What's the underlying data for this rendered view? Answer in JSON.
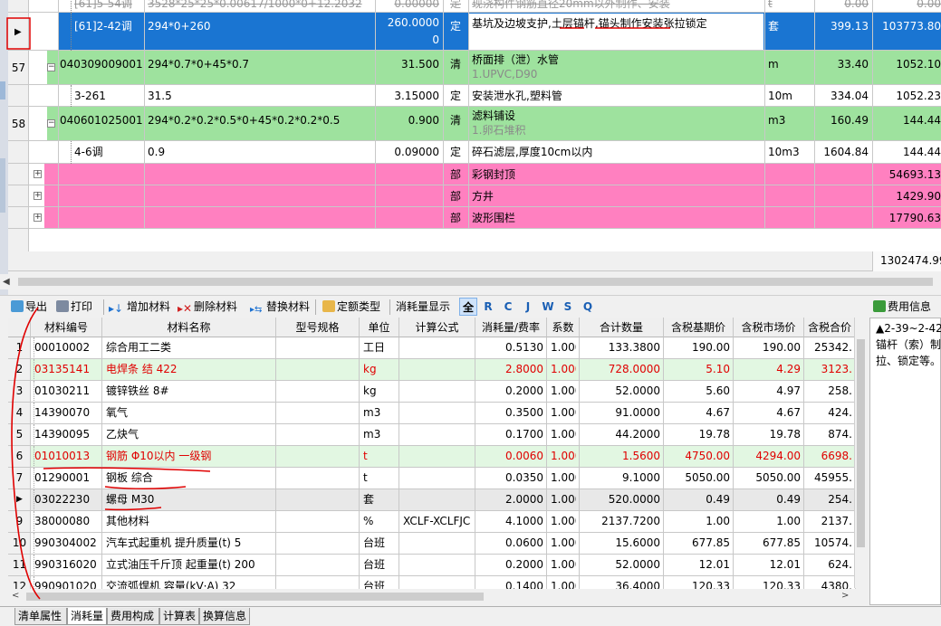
{
  "upper": {
    "rows": [
      {
        "num": "",
        "code": "[61]5-54调",
        "expr": "3528*25*25*0.00617/1000*0+12.2032",
        "qty": "0.00000",
        "cat": "定",
        "name": "现浇构件钢筋直径20mm以外制作、安装",
        "unit": "t",
        "price": "0.00",
        "total": "0.00"
      },
      {
        "num": "",
        "code": "[61]2-42调",
        "expr": "294*0+260",
        "qty": "260.0000\n0",
        "cat": "定",
        "name": "基坑及边坡支护,土层锚杆,锚头制作安装张拉锁定",
        "unit": "套",
        "price": "399.13",
        "total": "103773.80"
      },
      {
        "num": "57",
        "code": "040309009001",
        "expr": "294*0.7*0+45*0.7",
        "qty": "31.500",
        "cat": "清",
        "name": "桥面排（泄）水管",
        "sub": "1.UPVC,D90",
        "unit": "m",
        "price": "33.40",
        "total": "1052.10"
      },
      {
        "num": "",
        "code": "3-261",
        "expr": "31.5",
        "qty": "3.15000",
        "cat": "定",
        "name": "安装泄水孔,塑料管",
        "unit": "10m",
        "price": "334.04",
        "total": "1052.23"
      },
      {
        "num": "58",
        "code": "040601025001",
        "expr": "294*0.2*0.2*0.5*0+45*0.2*0.2*0.5",
        "qty": "0.900",
        "cat": "清",
        "name": "滤料铺设",
        "sub": "1.卵石堆积",
        "unit": "m3",
        "price": "160.49",
        "total": "144.44"
      },
      {
        "num": "",
        "code": "4-6调",
        "expr": "0.9",
        "qty": "0.09000",
        "cat": "定",
        "name": "碎石滤层,厚度10cm以内",
        "unit": "10m3",
        "price": "1604.84",
        "total": "144.44"
      },
      {
        "num": "",
        "code": "",
        "expr": "",
        "qty": "",
        "cat": "部",
        "name": "彩钢封顶",
        "unit": "",
        "price": "",
        "total": "54693.13"
      },
      {
        "num": "",
        "code": "",
        "expr": "",
        "qty": "",
        "cat": "部",
        "name": "方井",
        "unit": "",
        "price": "",
        "total": "1429.90"
      },
      {
        "num": "",
        "code": "",
        "expr": "",
        "qty": "",
        "cat": "部",
        "name": "波形围栏",
        "unit": "",
        "price": "",
        "total": "17790.63"
      }
    ],
    "grand_total": "1302474.99"
  },
  "toolbar": {
    "export": "导出",
    "print": "打印",
    "add_material": "增加材料",
    "delete_material": "删除材料",
    "replace_material": "替换材料",
    "quota_type": "定额类型",
    "consumption_display": "消耗量显示",
    "filters": [
      "全",
      "R",
      "C",
      "J",
      "W",
      "S",
      "Q"
    ],
    "fee_info": "费用信息"
  },
  "headers": [
    "材料编号",
    "材料名称",
    "型号规格",
    "单位",
    "计算公式",
    "消耗量/费率",
    "系数",
    "合计数量",
    "含税基期价",
    "含税市场价",
    "含税合价"
  ],
  "materials": [
    {
      "n": "1",
      "code": "00010002",
      "name": "综合用工二类",
      "spec": "",
      "unit": "工日",
      "formula": "",
      "consume": "0.5130",
      "coef": "1.000",
      "total": "133.3800",
      "base": "190.00",
      "market": "190.00",
      "amount": "25342."
    },
    {
      "n": "2",
      "code": "03135141",
      "name": "电焊条 结 422",
      "spec": "",
      "unit": "kg",
      "formula": "",
      "consume": "2.8000",
      "coef": "1.000",
      "total": "728.0000",
      "base": "5.10",
      "market": "4.29",
      "amount": "3123."
    },
    {
      "n": "3",
      "code": "01030211",
      "name": "镀锌铁丝 8#",
      "spec": "",
      "unit": "kg",
      "formula": "",
      "consume": "0.2000",
      "coef": "1.000",
      "total": "52.0000",
      "base": "5.60",
      "market": "4.97",
      "amount": "258."
    },
    {
      "n": "4",
      "code": "14390070",
      "name": "氧气",
      "spec": "",
      "unit": "m3",
      "formula": "",
      "consume": "0.3500",
      "coef": "1.000",
      "total": "91.0000",
      "base": "4.67",
      "market": "4.67",
      "amount": "424."
    },
    {
      "n": "5",
      "code": "14390095",
      "name": "乙炔气",
      "spec": "",
      "unit": "m3",
      "formula": "",
      "consume": "0.1700",
      "coef": "1.000",
      "total": "44.2000",
      "base": "19.78",
      "market": "19.78",
      "amount": "874."
    },
    {
      "n": "6",
      "code": "01010013",
      "name": "钢筋 Φ10以内 一级钢",
      "spec": "",
      "unit": "t",
      "formula": "",
      "consume": "0.0060",
      "coef": "1.000",
      "total": "1.5600",
      "base": "4750.00",
      "market": "4294.00",
      "amount": "6698."
    },
    {
      "n": "7",
      "code": "01290001",
      "name": "钢板 综合",
      "spec": "",
      "unit": "t",
      "formula": "",
      "consume": "0.0350",
      "coef": "1.000",
      "total": "9.1000",
      "base": "5050.00",
      "market": "5050.00",
      "amount": "45955."
    },
    {
      "n": "8",
      "code": "03022230",
      "name": "螺母 M30",
      "spec": "",
      "unit": "套",
      "formula": "",
      "consume": "2.0000",
      "coef": "1.000",
      "total": "520.0000",
      "base": "0.49",
      "market": "0.49",
      "amount": "254."
    },
    {
      "n": "9",
      "code": "38000080",
      "name": "其他材料",
      "spec": "",
      "unit": "%",
      "formula": "XCLF-XCLFJC",
      "consume": "4.1000",
      "coef": "1.000",
      "total": "2137.7200",
      "base": "1.00",
      "market": "1.00",
      "amount": "2137."
    },
    {
      "n": "10",
      "code": "990304002",
      "name": "汽车式起重机 提升质量(t) 5",
      "spec": "",
      "unit": "台班",
      "formula": "",
      "consume": "0.0600",
      "coef": "1.000",
      "total": "15.6000",
      "base": "677.85",
      "market": "677.85",
      "amount": "10574."
    },
    {
      "n": "11",
      "code": "990316020",
      "name": "立式油压千斤顶 起重量(t) 200",
      "spec": "",
      "unit": "台班",
      "formula": "",
      "consume": "0.2000",
      "coef": "1.000",
      "total": "52.0000",
      "base": "12.01",
      "market": "12.01",
      "amount": "624."
    },
    {
      "n": "12",
      "code": "990901020",
      "name": "交流弧焊机 容量(kV·A) 32",
      "spec": "",
      "unit": "台班",
      "formula": "",
      "consume": "0.1400",
      "coef": "1.000",
      "total": "36.4000",
      "base": "120.33",
      "market": "120.33",
      "amount": "4380."
    }
  ],
  "side_note": "▲2-39~2-42\n锚杆（索）制\n拉、锁定等。",
  "bottom_tabs": [
    "清单属性",
    "消耗量",
    "费用构成",
    "计算表",
    "换算信息"
  ],
  "colors": {
    "selected": "#1a75d2",
    "green": "#9ee29e",
    "pink": "#ff80c0",
    "light_green": "#e2f7e2",
    "red_annotation": "#e00000"
  }
}
